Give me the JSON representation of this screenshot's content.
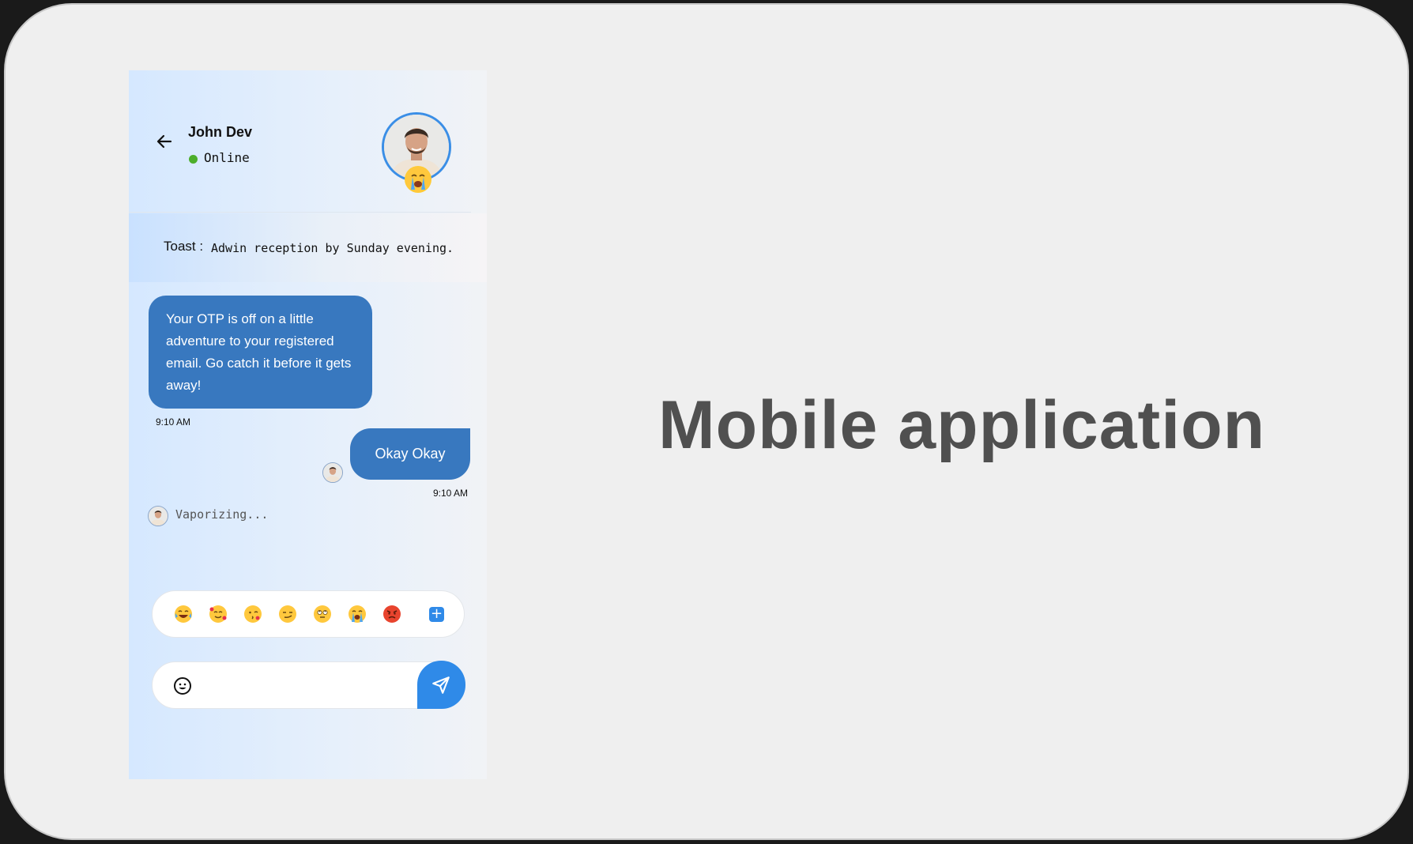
{
  "contact": {
    "name": "John Dev",
    "status": "Online",
    "status_color": "#4cae2b",
    "avatar_icon": "person-avatar-icon",
    "mood_icon": "loudly-crying-face-icon"
  },
  "toast": {
    "label": "Toast :",
    "message": "Adwin reception by Sunday evening."
  },
  "messages": [
    {
      "direction": "incoming",
      "text": "Your OTP is off on a little adventure to your registered email. Go catch it before it gets away!",
      "time": "9:10 AM"
    },
    {
      "direction": "outgoing",
      "text": "Okay Okay",
      "time": "9:10 AM"
    }
  ],
  "typing": {
    "text": "Vaporizing..."
  },
  "reactions": [
    {
      "name": "tears-of-joy",
      "emoji": "😂"
    },
    {
      "name": "smiling-face-with-hearts",
      "emoji": "🥰"
    },
    {
      "name": "face-blowing-kiss",
      "emoji": "😘"
    },
    {
      "name": "smirking-face",
      "emoji": "😏"
    },
    {
      "name": "face-with-rolling-eyes",
      "emoji": "🙄"
    },
    {
      "name": "loudly-crying-face",
      "emoji": "😭"
    },
    {
      "name": "pouting-face",
      "emoji": "😡"
    }
  ],
  "composer": {
    "placeholder": "",
    "value": ""
  },
  "hero": {
    "title": "Mobile application"
  },
  "colors": {
    "accent": "#2f8ae8",
    "bubble": "#3878bf",
    "background": "#efefef",
    "title": "#505050"
  }
}
